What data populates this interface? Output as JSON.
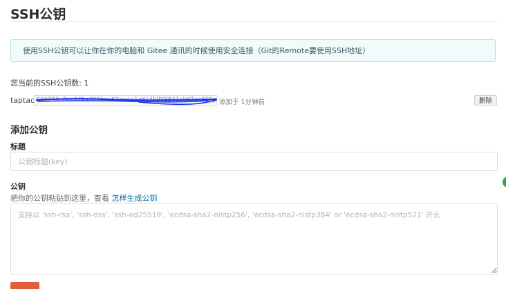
{
  "page": {
    "title": "SSH公钥"
  },
  "notice": {
    "text": "使用SSH公钥可以让你在你的电脑和 Gitee 通讯的时候使用安全连接（Git的Remote要使用SSH地址）"
  },
  "keys": {
    "count_label": "您当前的SSH公钥数: 1",
    "items": [
      {
        "name": "taptaq",
        "fingerprint": "SHA256:Oen1Ckz6K5heuK3axca1zWjfhUY8841ckH7as6S6pnwo",
        "added": "添加于 1分钟前",
        "delete_label": "删除"
      }
    ]
  },
  "add_form": {
    "section_title": "添加公钥",
    "title_label": "标题",
    "title_placeholder": "公钥标题(key)",
    "key_label": "公钥",
    "help_text": "把你的公钥粘贴到这里，查看 ",
    "help_link": "怎样生成公钥",
    "key_placeholder": "支持以 'ssh-rsa', 'ssh-dss', 'ssh-ed25519', 'ecdsa-sha2-nistp256', 'ecdsa-sha2-nistp384' or 'ecdsa-sha2-nistp521' 开头"
  },
  "colors": {
    "accent": "#e15d3b",
    "link": "#0d68a8",
    "notice_bg": "#f2fbfc",
    "notice_border": "#a9dfe4",
    "redaction_ink": "#1a2fe0"
  }
}
